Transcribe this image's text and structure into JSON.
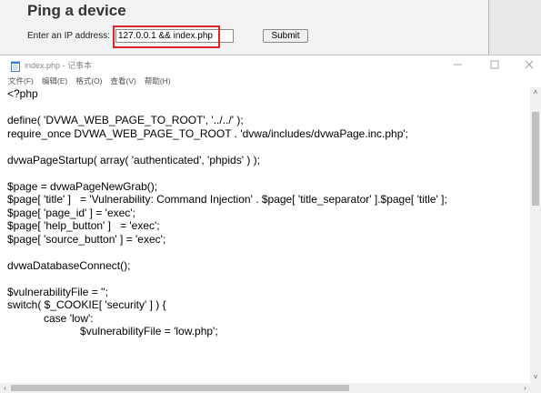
{
  "web_page": {
    "title": "Ping a device",
    "ip_label": "Enter an IP address:",
    "ip_value": "127.0.0.1 && index.php",
    "submit_label": "Submit",
    "highlight_color": "#e0242a"
  },
  "notepad": {
    "title": "index.php - 记事本",
    "icon": "notepad-icon",
    "window_controls": [
      "minimize-icon",
      "maximize-icon",
      "close-icon"
    ],
    "menu": [
      {
        "label": "文件(F)"
      },
      {
        "label": "编辑(E)"
      },
      {
        "label": "格式(O)"
      },
      {
        "label": "查看(V)"
      },
      {
        "label": "帮助(H)"
      }
    ],
    "lines": [
      "<?php",
      "",
      "define( 'DVWA_WEB_PAGE_TO_ROOT', '../../' );",
      "require_once DVWA_WEB_PAGE_TO_ROOT . 'dvwa/includes/dvwaPage.inc.php';",
      "",
      "dvwaPageStartup( array( 'authenticated', 'phpids' ) );",
      "",
      "$page = dvwaPageNewGrab();",
      "$page[ 'title' ]   = 'Vulnerability: Command Injection' . $page[ 'title_separator' ].$page[ 'title' ];",
      "$page[ 'page_id' ] = 'exec';",
      "$page[ 'help_button' ]   = 'exec';",
      "$page[ 'source_button' ] = 'exec';",
      "",
      "dvwaDatabaseConnect();",
      "",
      "$vulnerabilityFile = '';",
      "switch( $_COOKIE[ 'security' ] ) {",
      "\tcase 'low':",
      "\t\t$vulnerabilityFile = 'low.php';"
    ]
  }
}
